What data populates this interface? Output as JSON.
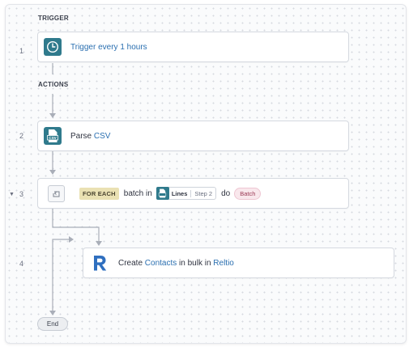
{
  "sections": {
    "trigger": "TRIGGER",
    "actions": "ACTIONS"
  },
  "steps": [
    {
      "number": "1",
      "label": "Trigger every 1 hours",
      "icon": "clock-icon"
    },
    {
      "number": "2",
      "prefix": "Parse ",
      "link": "CSV",
      "icon": "csv-icon"
    },
    {
      "number": "3",
      "keyword": "FOR EACH",
      "text_a": "batch in",
      "datapill_name": "Lines",
      "datapill_step": "Step 2",
      "text_b": "do",
      "variable": "Batch",
      "icon": "repeat-icon"
    },
    {
      "number": "4",
      "prefix": "Create ",
      "object": "Contacts",
      "middle": " in bulk in ",
      "app": "Reltio",
      "icon": "reltio-logo"
    }
  ],
  "end_label": "End",
  "colors": {
    "accent_teal": "#2f7a8c",
    "link_blue": "#2a6fb0",
    "foreach_tag": "#eae1b3",
    "batch_tag": "#f9e7ec",
    "reltio_blue": "#2f6fbf"
  }
}
